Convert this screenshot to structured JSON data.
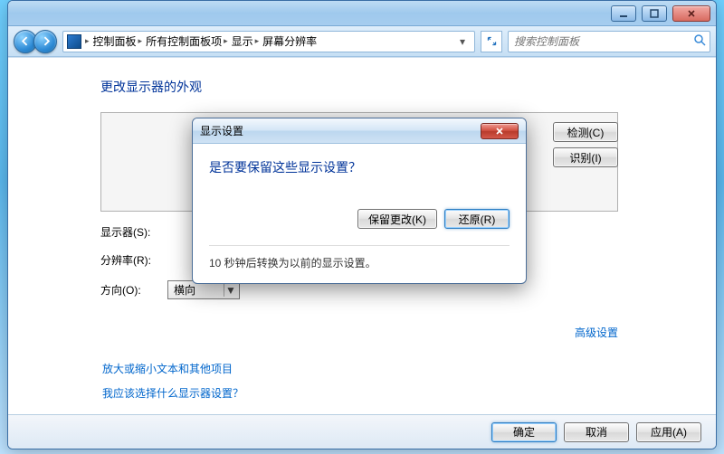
{
  "window": {
    "sys_min": "min",
    "sys_max": "max",
    "sys_close": "close"
  },
  "breadcrumb": {
    "items": [
      "控制面板",
      "所有控制面板项",
      "显示",
      "屏幕分辨率"
    ]
  },
  "search": {
    "placeholder": "搜索控制面板"
  },
  "page": {
    "title": "更改显示器的外观",
    "detect_btn": "检测(C)",
    "identify_btn": "识别(I)",
    "display_label": "显示器(S):",
    "resolution_label": "分辨率(R):",
    "orientation_label": "方向(O):",
    "orientation_value": "横向",
    "advanced_link": "高级设置",
    "link_text_size": "放大或缩小文本和其他项目",
    "link_which_display": "我应该选择什么显示器设置？"
  },
  "footer": {
    "ok": "确定",
    "cancel": "取消",
    "apply": "应用(A)"
  },
  "modal": {
    "title": "显示设置",
    "heading": "是否要保留这些显示设置？",
    "keep_btn": "保留更改(K)",
    "revert_btn": "还原(R)",
    "message": "10 秒钟后转换为以前的显示设置。"
  }
}
